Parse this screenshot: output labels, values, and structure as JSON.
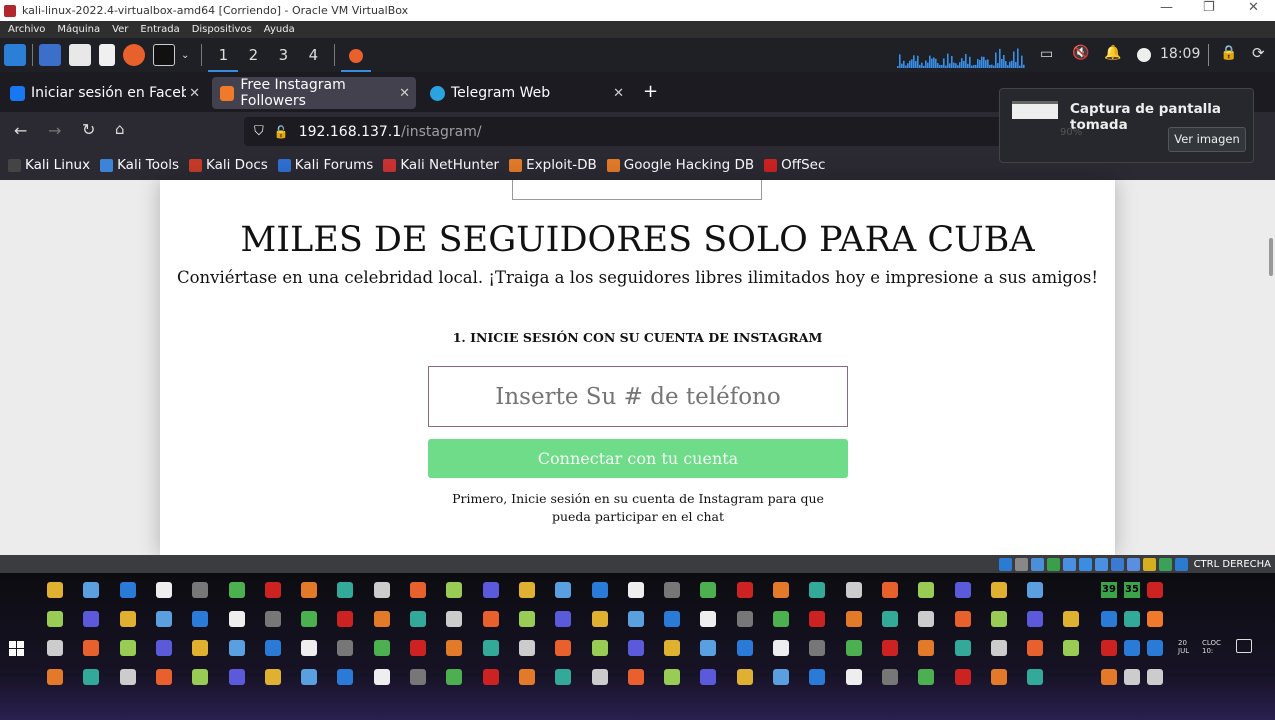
{
  "window": {
    "title": "kali-linux-2022.4-virtualbox-amd64 [Corriendo] - Oracle VM VirtualBox",
    "minimize": "—",
    "restore": "❐",
    "close": "✕"
  },
  "menu": [
    "Archivo",
    "Máquina",
    "Ver",
    "Entrada",
    "Dispositivos",
    "Ayuda"
  ],
  "panel": {
    "workspaces": [
      "1",
      "2",
      "3",
      "4"
    ],
    "active_workspace": "1",
    "clock": "18:09",
    "launchers": [
      {
        "name": "kali-menu-icon",
        "color": "#2c7fd6"
      },
      {
        "name": "desktop-icon",
        "color": "#3b6fc9"
      },
      {
        "name": "files-icon",
        "color": "#e8e8e8"
      },
      {
        "name": "text-editor-icon",
        "color": "#f0f0f0"
      },
      {
        "name": "firefox-icon",
        "color": "#e8602c"
      },
      {
        "name": "terminal-icon",
        "color": "#111"
      }
    ]
  },
  "tabs": [
    {
      "label": "Iniciar sesión en Facebook",
      "icon": "facebook-icon",
      "color": "#1877f2",
      "active": false
    },
    {
      "label": "Free Instagram Followers",
      "icon": "xampp-icon",
      "color": "#f07a2a",
      "active": true
    },
    {
      "label": "Telegram Web",
      "icon": "telegram-icon",
      "color": "#2aa3e0",
      "active": false
    }
  ],
  "new_tab": "+",
  "url": {
    "host": "192.168.137.1",
    "path": "/instagram/"
  },
  "bookmarks": [
    {
      "label": "Kali Linux",
      "color": "#444"
    },
    {
      "label": "Kali Tools",
      "color": "#3c84d8"
    },
    {
      "label": "Kali Docs",
      "color": "#c63b2a"
    },
    {
      "label": "Kali Forums",
      "color": "#2f6fd1"
    },
    {
      "label": "Kali NetHunter",
      "color": "#c33"
    },
    {
      "label": "Exploit-DB",
      "color": "#e27a2a"
    },
    {
      "label": "Google Hacking DB",
      "color": "#e27a2a"
    },
    {
      "label": "OffSec",
      "color": "#c22"
    }
  ],
  "notification": {
    "title": "Captura de pantalla tomada",
    "button": "Ver imagen",
    "zoom": "90%"
  },
  "page": {
    "heading": "MILES DE SEGUIDORES SOLO PARA CUBA",
    "subtitle": "Conviértase en una celebridad local. ¡Traiga a los seguidores libres ilimitados hoy e impresione a sus amigos!",
    "step": "1. INICIE SESIÓN CON SU CUENTA DE INSTAGRAM",
    "phone_placeholder": "Inserte Su # de teléfono",
    "connect_button": "Connectar con tu cuenta",
    "note": "Primero, Inicie sesión en su cuenta de Instagram para que pueda participar en el chat",
    "accent": "#6edc88"
  },
  "vbox_status": {
    "host_key": "CTRL DERECHA"
  },
  "taskbar": {
    "tray": {
      "badge1": "39",
      "badge2": "35",
      "date": "20 JUL",
      "clock": "CLOC 10:"
    }
  },
  "colors": {
    "active_tab": "#42414d",
    "button_green": "#6edc88",
    "placeholder": "#c98fae"
  }
}
